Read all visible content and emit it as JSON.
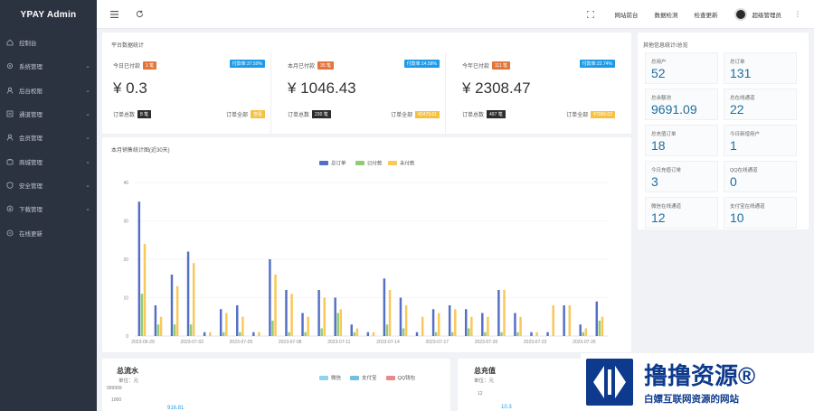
{
  "brand": "YPAY Admin",
  "sidebar": {
    "items": [
      {
        "label": "控制台",
        "icon": "home-icon",
        "arrow": false
      },
      {
        "label": "系统管理",
        "icon": "gear-icon",
        "arrow": true
      },
      {
        "label": "后台权限",
        "icon": "user-icon",
        "arrow": true
      },
      {
        "label": "通道管理",
        "icon": "list-icon",
        "arrow": true
      },
      {
        "label": "会员管理",
        "icon": "user-icon",
        "arrow": true
      },
      {
        "label": "商城管理",
        "icon": "cart-icon",
        "arrow": true
      },
      {
        "label": "安全管理",
        "icon": "shield-icon",
        "arrow": true
      },
      {
        "label": "下载管理",
        "icon": "download-icon",
        "arrow": true
      },
      {
        "label": "在线更新",
        "icon": "refresh-icon",
        "arrow": false
      }
    ]
  },
  "header": {
    "links": [
      "网站前台",
      "数据检测",
      "检查更新"
    ],
    "user": "超级管理员"
  },
  "platform": {
    "title": "平台数据统计",
    "stats": [
      {
        "label": "今日已付款",
        "count_badge": "1 笔",
        "rate_badge": "付款率:37.50%",
        "amount": "¥ 0.3",
        "total_label": "订单总数",
        "total_badge": "8 笔",
        "all_label": "订单全部",
        "all_badge": "查看"
      },
      {
        "label": "本月已付款",
        "count_badge": "35 笔",
        "rate_badge": "付款率:14.58%",
        "amount": "¥ 1046.43",
        "total_label": "订单总数",
        "total_badge": "230 笔",
        "all_label": "订单全部",
        "all_badge": "¥2479.61"
      },
      {
        "label": "今年已付款",
        "count_badge": "111 笔",
        "rate_badge": "付款率:22.74%",
        "amount": "¥ 2308.47",
        "total_label": "订单总数",
        "total_badge": "497 笔",
        "all_label": "订单全部",
        "all_badge": "¥7066.02"
      }
    ]
  },
  "other": {
    "title": "其他信息统计/总览",
    "items": [
      {
        "label": "总用户",
        "value": "52"
      },
      {
        "label": "总订单",
        "value": "131"
      },
      {
        "label": "总余额池",
        "value": "9691.09"
      },
      {
        "label": "总在线通道",
        "value": "22"
      },
      {
        "label": "总充值订单",
        "value": "18"
      },
      {
        "label": "今日新增用户",
        "value": "1"
      },
      {
        "label": "今日充值订单",
        "value": "3"
      },
      {
        "label": "QQ在线通道",
        "value": "0"
      },
      {
        "label": "微信在线通道",
        "value": "12"
      },
      {
        "label": "支付宝在线通道",
        "value": "10"
      }
    ]
  },
  "colors": {
    "sidebar": "#2c3340",
    "total": "#5470c6",
    "paid": "#91cc75",
    "unpaid": "#fac858",
    "accent": "#1e9be8"
  },
  "chart_data": [
    {
      "type": "bar",
      "title": "本月销售统计图(近30天)",
      "categories": [
        "2023-06-29",
        "2023-06-30",
        "2023-07-01",
        "2023-07-02",
        "2023-07-03",
        "2023-07-04",
        "2023-07-05",
        "2023-07-06",
        "2023-07-07",
        "2023-07-08",
        "2023-07-09",
        "2023-07-10",
        "2023-07-11",
        "2023-07-12",
        "2023-07-13",
        "2023-07-14",
        "2023-07-15",
        "2023-07-16",
        "2023-07-17",
        "2023-07-18",
        "2023-07-19",
        "2023-07-20",
        "2023-07-21",
        "2023-07-22",
        "2023-07-23",
        "2023-07-24",
        "2023-07-25",
        "2023-07-26",
        "2023-07-27"
      ],
      "tick_labels": [
        "2023-06-29",
        "2023-07-02",
        "2023-07-05",
        "2023-07-08",
        "2023-07-11",
        "2023-07-14",
        "2023-07-17",
        "2023-07-20",
        "2023-07-23",
        "2023-07-26"
      ],
      "series": [
        {
          "name": "总订单",
          "values": [
            35,
            8,
            16,
            22,
            1,
            7,
            8,
            1,
            20,
            12,
            6,
            12,
            10,
            3,
            1,
            15,
            10,
            1,
            7,
            8,
            7,
            6,
            12,
            6,
            1,
            1,
            8,
            3,
            9
          ]
        },
        {
          "name": "已付款",
          "values": [
            11,
            3,
            3,
            3,
            0,
            1,
            1,
            0,
            4,
            1,
            1,
            2,
            6,
            1,
            0,
            3,
            2,
            0,
            1,
            1,
            2,
            1,
            1,
            1,
            0,
            0,
            0,
            1,
            4
          ]
        },
        {
          "name": "未付款",
          "values": [
            24,
            5,
            13,
            19,
            1,
            6,
            5,
            1,
            16,
            11,
            5,
            10,
            7,
            2,
            1,
            12,
            8,
            5,
            6,
            7,
            5,
            5,
            12,
            5,
            1,
            8,
            8,
            2,
            5
          ]
        }
      ],
      "ylim": [
        0,
        40
      ],
      "yticks": [
        0,
        10,
        20,
        30,
        40
      ],
      "legend": "top-center",
      "grid": true
    },
    {
      "type": "bar",
      "title": "总流水",
      "subtitle": "单位：元",
      "series": [
        {
          "name": "微信"
        },
        {
          "name": "支付宝"
        },
        {
          "name": "QQ钱包"
        }
      ],
      "yticks": [
        999999,
        1000
      ],
      "data_labels": [
        "916.81"
      ]
    },
    {
      "type": "bar",
      "title": "总充值",
      "subtitle": "单位：元",
      "yticks": [
        12
      ],
      "data_labels": [
        "10.3"
      ]
    }
  ],
  "watermark": {
    "main": "撸撸资源®",
    "sub": "白嫖互联网资源的网站"
  }
}
